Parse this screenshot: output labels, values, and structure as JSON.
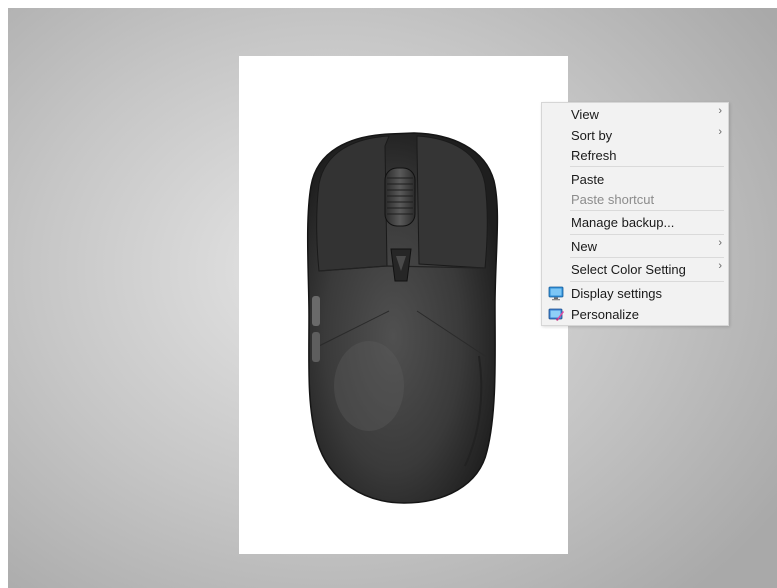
{
  "context_menu": {
    "items": [
      {
        "label": "View",
        "has_submenu": true
      },
      {
        "label": "Sort by",
        "has_submenu": true
      },
      {
        "label": "Refresh",
        "has_submenu": false
      },
      {
        "label": "Paste",
        "has_submenu": false
      },
      {
        "label": "Paste shortcut",
        "has_submenu": false,
        "disabled": true
      },
      {
        "label": "Manage backup...",
        "has_submenu": false
      },
      {
        "label": "New",
        "has_submenu": true
      },
      {
        "label": "Select Color Setting",
        "has_submenu": true
      },
      {
        "label": "Display settings",
        "has_submenu": false,
        "icon": "display-icon"
      },
      {
        "label": "Personalize",
        "has_submenu": false,
        "icon": "personalize-icon"
      }
    ],
    "chevron_glyph": "›"
  },
  "colors": {
    "mouse_body": "#3a3a3a",
    "menu_background": "#f2f2f2",
    "disabled_text": "#8c8c8c"
  }
}
